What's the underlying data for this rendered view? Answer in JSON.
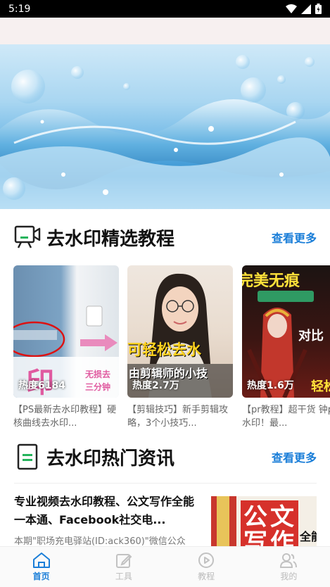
{
  "status_bar": {
    "time": "5:19"
  },
  "section1": {
    "title": "去水印精选教程",
    "more": "查看更多"
  },
  "cards": [
    {
      "heat": "热度6184",
      "title": "【PS最新去水印教程】硬核曲线去水印..."
    },
    {
      "heat": "热度2.7万",
      "title": "【剪辑技巧】新手剪辑攻略，3个小技巧..."
    },
    {
      "heat": "热度1.6万",
      "title": "【pr教程】超干货 钟pr去水印！最..."
    }
  ],
  "card_overlays": {
    "card1": {
      "mark": "印",
      "side_text1": "无损去",
      "side_text2": "三分钟"
    },
    "card2": {
      "line1": "可轻松去水",
      "line2": "由剪辑师的小技"
    },
    "card3": {
      "top": "完美无痕",
      "vs": "对比",
      "bottom": "轻松"
    }
  },
  "section2": {
    "title": "去水印热门资讯",
    "more": "查看更多"
  },
  "news": {
    "title": "专业视频去水印教程、公文写作全能一本通、Facebook社交电...",
    "desc": "本期\"职场充电驿站(ID:ack360)\"微信公众",
    "thumb_text1": "公文",
    "thumb_text2": "写作",
    "thumb_text3": "全能"
  },
  "tabs": [
    {
      "label": "首页",
      "icon": "home-icon",
      "active": true
    },
    {
      "label": "工具",
      "icon": "edit-icon",
      "active": false
    },
    {
      "label": "教程",
      "icon": "play-icon",
      "active": false
    },
    {
      "label": "我的",
      "icon": "user-icon",
      "active": false
    }
  ],
  "colors": {
    "accent": "#1a7ed8",
    "icon_green": "#25b45c"
  }
}
